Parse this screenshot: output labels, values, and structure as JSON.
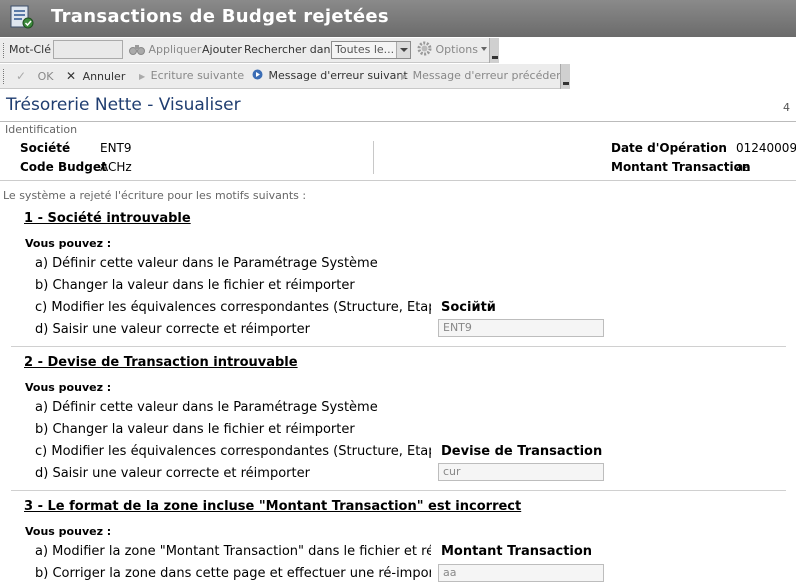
{
  "window": {
    "title": "Transactions de Budget rejetées"
  },
  "toolbar1": {
    "keyword_label": "Mot-Clé",
    "keyword_value": "",
    "apply": "Appliquer",
    "add": "Ajouter",
    "search_in": "Rechercher dans",
    "scope_value": "Toutes le...",
    "options": "Options"
  },
  "toolbar2": {
    "ok": "OK",
    "cancel": "Annuler",
    "next_entry": "Ecriture suivante",
    "next_error": "Message d'erreur suivant",
    "prev_error": "Message d'erreur précédent"
  },
  "page": {
    "title": "Trésorerie Nette - Visualiser",
    "number": "4"
  },
  "identification": {
    "legend": "Identification",
    "company_label": "Société",
    "company_value": "ENT9",
    "budget_code_label": "Code Budget",
    "budget_code_value": "ACHz",
    "op_date_label": "Date d'Opération",
    "op_date_value": "01240009",
    "amount_label": "Montant Transaction",
    "amount_value": "aa"
  },
  "intro": "Le système a rejeté l'écriture pour les motifs suivants :",
  "sections": [
    {
      "title": "1 - Société introuvable",
      "you_can": "Vous pouvez :",
      "options": [
        "a) Définir cette valeur dans le Paramétrage Système",
        "b) Changer la valeur dans le fichier et réimporter",
        "c) Modifier les équivalences correspondantes (Structure, Etape",
        "d) Saisir une valeur correcte et réimporter"
      ],
      "field_label": "Sociйtй",
      "field_value": "ENT9"
    },
    {
      "title": "2 - Devise de Transaction introuvable",
      "you_can": "Vous pouvez :",
      "options": [
        "a) Définir cette valeur dans le Paramétrage Système",
        "b) Changer la valeur dans le fichier et réimporter",
        "c) Modifier les équivalences correspondantes (Structure, Etape",
        "d) Saisir une valeur correcte et réimporter"
      ],
      "field_label": "Devise de Transaction",
      "field_value": "cur"
    },
    {
      "title": "3 - Le format de la zone incluse \"Montant Transaction\" est incorrect",
      "you_can": "Vous pouvez :",
      "options": [
        "a) Modifier la zone \"Montant Transaction\" dans le fichier et ré-i",
        "b) Corriger la zone dans cette page et effectuer une ré-importa"
      ],
      "field_label": "Montant Transaction",
      "field_value": "aa"
    }
  ]
}
